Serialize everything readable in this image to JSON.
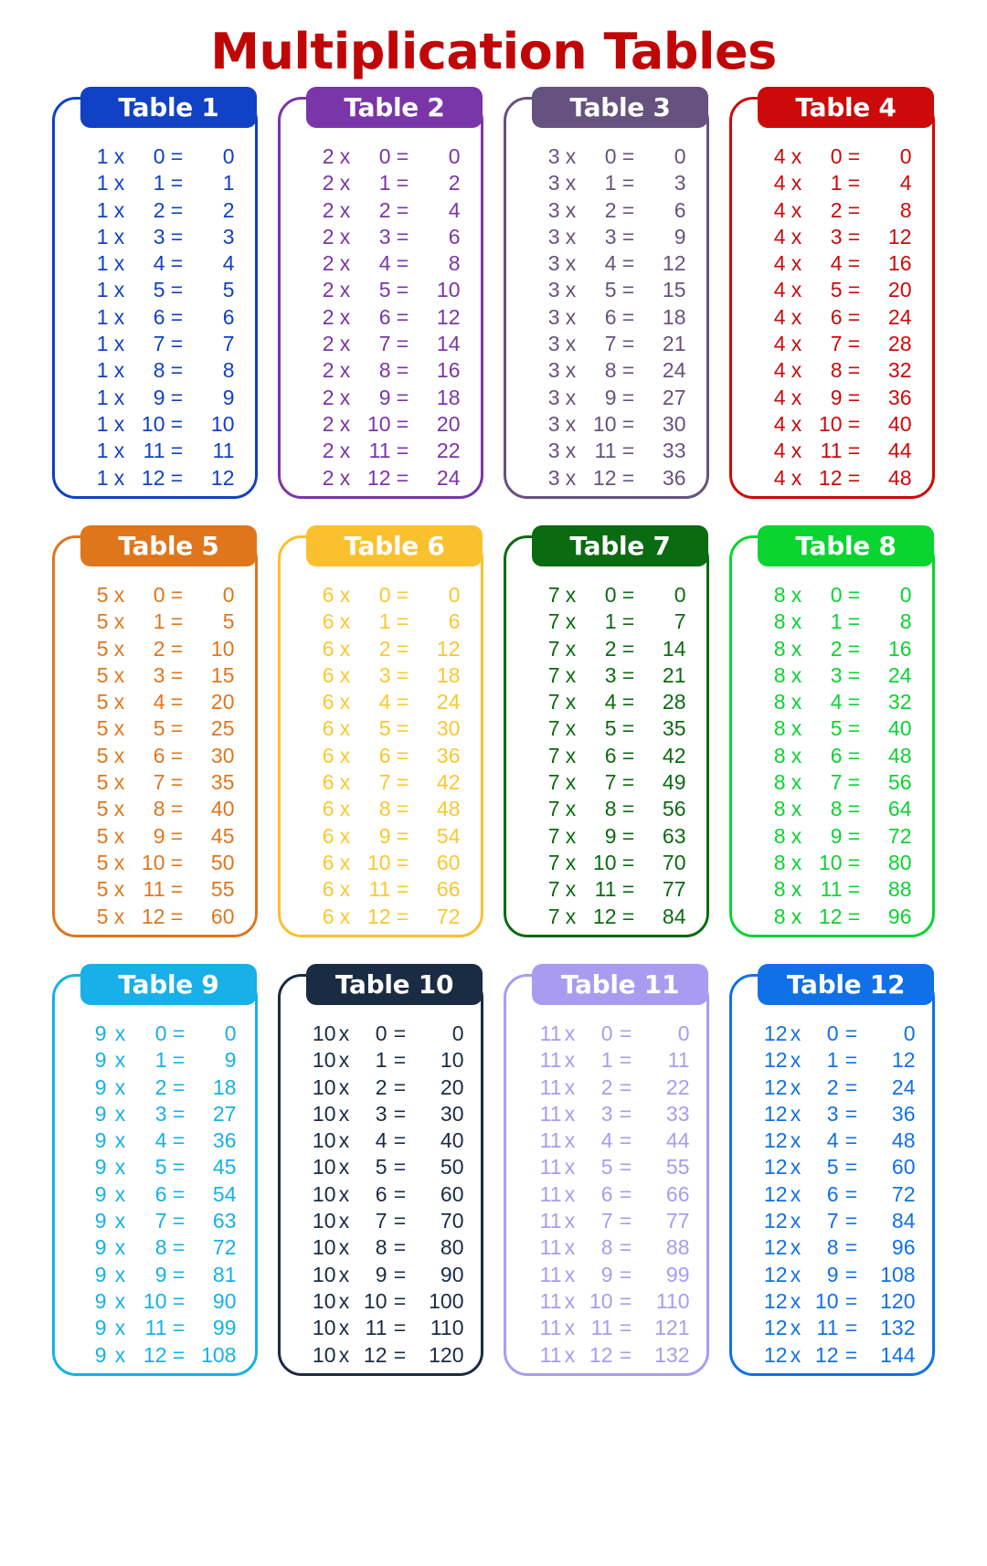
{
  "title": "Multiplication Tables",
  "title_color": "#c00606",
  "columns": 4,
  "operator": "x",
  "equals": "=",
  "tables": [
    {
      "name": "Table 1",
      "color": "#1141c4",
      "header_color": "#1141c4",
      "text_color": "#1141c4",
      "multiplicand": 1,
      "rows": [
        {
          "a": "1",
          "b": "0",
          "r": "0"
        },
        {
          "a": "1",
          "b": "1",
          "r": "1"
        },
        {
          "a": "1",
          "b": "2",
          "r": "2"
        },
        {
          "a": "1",
          "b": "3",
          "r": "3"
        },
        {
          "a": "1",
          "b": "4",
          "r": "4"
        },
        {
          "a": "1",
          "b": "5",
          "r": "5"
        },
        {
          "a": "1",
          "b": "6",
          "r": "6"
        },
        {
          "a": "1",
          "b": "7",
          "r": "7"
        },
        {
          "a": "1",
          "b": "8",
          "r": "8"
        },
        {
          "a": "1",
          "b": "9",
          "r": "9"
        },
        {
          "a": "1",
          "b": "10",
          "r": "10"
        },
        {
          "a": "1",
          "b": "11",
          "r": "11"
        },
        {
          "a": "1",
          "b": "12",
          "r": "12"
        }
      ]
    },
    {
      "name": "Table 2",
      "color": "#7a35a8",
      "header_color": "#7a35a8",
      "text_color": "#7a35a8",
      "multiplicand": 2,
      "rows": [
        {
          "a": "2",
          "b": "0",
          "r": "0"
        },
        {
          "a": "2",
          "b": "1",
          "r": "2"
        },
        {
          "a": "2",
          "b": "2",
          "r": "4"
        },
        {
          "a": "2",
          "b": "3",
          "r": "6"
        },
        {
          "a": "2",
          "b": "4",
          "r": "8"
        },
        {
          "a": "2",
          "b": "5",
          "r": "10"
        },
        {
          "a": "2",
          "b": "6",
          "r": "12"
        },
        {
          "a": "2",
          "b": "7",
          "r": "14"
        },
        {
          "a": "2",
          "b": "8",
          "r": "16"
        },
        {
          "a": "2",
          "b": "9",
          "r": "18"
        },
        {
          "a": "2",
          "b": "10",
          "r": "20"
        },
        {
          "a": "2",
          "b": "11",
          "r": "22"
        },
        {
          "a": "2",
          "b": "12",
          "r": "24"
        }
      ]
    },
    {
      "name": "Table 3",
      "color": "#66527e",
      "header_color": "#66527e",
      "text_color": "#66527e",
      "multiplicand": 3,
      "rows": [
        {
          "a": "3",
          "b": "0",
          "r": "0"
        },
        {
          "a": "3",
          "b": "1",
          "r": "3"
        },
        {
          "a": "3",
          "b": "2",
          "r": "6"
        },
        {
          "a": "3",
          "b": "3",
          "r": "9"
        },
        {
          "a": "3",
          "b": "4",
          "r": "12"
        },
        {
          "a": "3",
          "b": "5",
          "r": "15"
        },
        {
          "a": "3",
          "b": "6",
          "r": "18"
        },
        {
          "a": "3",
          "b": "7",
          "r": "21"
        },
        {
          "a": "3",
          "b": "8",
          "r": "24"
        },
        {
          "a": "3",
          "b": "9",
          "r": "27"
        },
        {
          "a": "3",
          "b": "10",
          "r": "30"
        },
        {
          "a": "3",
          "b": "11",
          "r": "33"
        },
        {
          "a": "3",
          "b": "12",
          "r": "36"
        }
      ]
    },
    {
      "name": "Table 4",
      "color": "#cc0a0a",
      "header_color": "#cc0a0a",
      "text_color": "#cc0a0a",
      "multiplicand": 4,
      "rows": [
        {
          "a": "4",
          "b": "0",
          "r": "0"
        },
        {
          "a": "4",
          "b": "1",
          "r": "4"
        },
        {
          "a": "4",
          "b": "2",
          "r": "8"
        },
        {
          "a": "4",
          "b": "3",
          "r": "12"
        },
        {
          "a": "4",
          "b": "4",
          "r": "16"
        },
        {
          "a": "4",
          "b": "5",
          "r": "20"
        },
        {
          "a": "4",
          "b": "6",
          "r": "24"
        },
        {
          "a": "4",
          "b": "7",
          "r": "28"
        },
        {
          "a": "4",
          "b": "8",
          "r": "32"
        },
        {
          "a": "4",
          "b": "9",
          "r": "36"
        },
        {
          "a": "4",
          "b": "10",
          "r": "40"
        },
        {
          "a": "4",
          "b": "11",
          "r": "44"
        },
        {
          "a": "4",
          "b": "12",
          "r": "48"
        }
      ]
    },
    {
      "name": "Table 5",
      "color": "#e0761c",
      "header_color": "#e0761c",
      "text_color": "#e0761c",
      "multiplicand": 5,
      "rows": [
        {
          "a": "5",
          "b": "0",
          "r": "0"
        },
        {
          "a": "5",
          "b": "1",
          "r": "5"
        },
        {
          "a": "5",
          "b": "2",
          "r": "10"
        },
        {
          "a": "5",
          "b": "3",
          "r": "15"
        },
        {
          "a": "5",
          "b": "4",
          "r": "20"
        },
        {
          "a": "5",
          "b": "5",
          "r": "25"
        },
        {
          "a": "5",
          "b": "6",
          "r": "30"
        },
        {
          "a": "5",
          "b": "7",
          "r": "35"
        },
        {
          "a": "5",
          "b": "8",
          "r": "40"
        },
        {
          "a": "5",
          "b": "9",
          "r": "45"
        },
        {
          "a": "5",
          "b": "10",
          "r": "50"
        },
        {
          "a": "5",
          "b": "11",
          "r": "55"
        },
        {
          "a": "5",
          "b": "12",
          "r": "60"
        }
      ]
    },
    {
      "name": "Table 6",
      "color": "#fbc02d",
      "header_color": "#fbc02d",
      "text_color": "#fbc72f",
      "multiplicand": 6,
      "rows": [
        {
          "a": "6",
          "b": "0",
          "r": "0"
        },
        {
          "a": "6",
          "b": "1",
          "r": "6"
        },
        {
          "a": "6",
          "b": "2",
          "r": "12"
        },
        {
          "a": "6",
          "b": "3",
          "r": "18"
        },
        {
          "a": "6",
          "b": "4",
          "r": "24"
        },
        {
          "a": "6",
          "b": "5",
          "r": "30"
        },
        {
          "a": "6",
          "b": "6",
          "r": "36"
        },
        {
          "a": "6",
          "b": "7",
          "r": "42"
        },
        {
          "a": "6",
          "b": "8",
          "r": "48"
        },
        {
          "a": "6",
          "b": "9",
          "r": "54"
        },
        {
          "a": "6",
          "b": "10",
          "r": "60"
        },
        {
          "a": "6",
          "b": "11",
          "r": "66"
        },
        {
          "a": "6",
          "b": "12",
          "r": "72"
        }
      ]
    },
    {
      "name": "Table 7",
      "color": "#0a6b11",
      "header_color": "#0a6b11",
      "text_color": "#0a6b11",
      "multiplicand": 7,
      "rows": [
        {
          "a": "7",
          "b": "0",
          "r": "0"
        },
        {
          "a": "7",
          "b": "1",
          "r": "7"
        },
        {
          "a": "7",
          "b": "2",
          "r": "14"
        },
        {
          "a": "7",
          "b": "3",
          "r": "21"
        },
        {
          "a": "7",
          "b": "4",
          "r": "28"
        },
        {
          "a": "7",
          "b": "5",
          "r": "35"
        },
        {
          "a": "7",
          "b": "6",
          "r": "42"
        },
        {
          "a": "7",
          "b": "7",
          "r": "49"
        },
        {
          "a": "7",
          "b": "8",
          "r": "56"
        },
        {
          "a": "7",
          "b": "9",
          "r": "63"
        },
        {
          "a": "7",
          "b": "10",
          "r": "70"
        },
        {
          "a": "7",
          "b": "11",
          "r": "77"
        },
        {
          "a": "7",
          "b": "12",
          "r": "84"
        }
      ]
    },
    {
      "name": "Table 8",
      "color": "#0ad430",
      "header_color": "#0ad430",
      "text_color": "#0ad430",
      "multiplicand": 8,
      "rows": [
        {
          "a": "8",
          "b": "0",
          "r": "0"
        },
        {
          "a": "8",
          "b": "1",
          "r": "8"
        },
        {
          "a": "8",
          "b": "2",
          "r": "16"
        },
        {
          "a": "8",
          "b": "3",
          "r": "24"
        },
        {
          "a": "8",
          "b": "4",
          "r": "32"
        },
        {
          "a": "8",
          "b": "5",
          "r": "40"
        },
        {
          "a": "8",
          "b": "6",
          "r": "48"
        },
        {
          "a": "8",
          "b": "7",
          "r": "56"
        },
        {
          "a": "8",
          "b": "8",
          "r": "64"
        },
        {
          "a": "8",
          "b": "9",
          "r": "72"
        },
        {
          "a": "8",
          "b": "10",
          "r": "80"
        },
        {
          "a": "8",
          "b": "11",
          "r": "88"
        },
        {
          "a": "8",
          "b": "12",
          "r": "96"
        }
      ]
    },
    {
      "name": "Table 9",
      "color": "#17b0e8",
      "header_color": "#17b0e8",
      "text_color": "#17b0e8",
      "multiplicand": 9,
      "rows": [
        {
          "a": "9",
          "b": "0",
          "r": "0"
        },
        {
          "a": "9",
          "b": "1",
          "r": "9"
        },
        {
          "a": "9",
          "b": "2",
          "r": "18"
        },
        {
          "a": "9",
          "b": "3",
          "r": "27"
        },
        {
          "a": "9",
          "b": "4",
          "r": "36"
        },
        {
          "a": "9",
          "b": "5",
          "r": "45"
        },
        {
          "a": "9",
          "b": "6",
          "r": "54"
        },
        {
          "a": "9",
          "b": "7",
          "r": "63"
        },
        {
          "a": "9",
          "b": "8",
          "r": "72"
        },
        {
          "a": "9",
          "b": "9",
          "r": "81"
        },
        {
          "a": "9",
          "b": "10",
          "r": "90"
        },
        {
          "a": "9",
          "b": "11",
          "r": "99"
        },
        {
          "a": "9",
          "b": "12",
          "r": "108"
        }
      ]
    },
    {
      "name": "Table 10",
      "color": "#1a2c44",
      "header_color": "#1a2c44",
      "text_color": "#1a2c44",
      "multiplicand": 10,
      "rows": [
        {
          "a": "10",
          "b": "0",
          "r": "0"
        },
        {
          "a": "10",
          "b": "1",
          "r": "10"
        },
        {
          "a": "10",
          "b": "2",
          "r": "20"
        },
        {
          "a": "10",
          "b": "3",
          "r": "30"
        },
        {
          "a": "10",
          "b": "4",
          "r": "40"
        },
        {
          "a": "10",
          "b": "5",
          "r": "50"
        },
        {
          "a": "10",
          "b": "6",
          "r": "60"
        },
        {
          "a": "10",
          "b": "7",
          "r": "70"
        },
        {
          "a": "10",
          "b": "8",
          "r": "80"
        },
        {
          "a": "10",
          "b": "9",
          "r": "90"
        },
        {
          "a": "10",
          "b": "10",
          "r": "100"
        },
        {
          "a": "10",
          "b": "11",
          "r": "110"
        },
        {
          "a": "10",
          "b": "12",
          "r": "120"
        }
      ]
    },
    {
      "name": "Table 11",
      "color": "#a99cf0",
      "header_color": "#a99cf0",
      "text_color": "#a99cf0",
      "multiplicand": 11,
      "rows": [
        {
          "a": "11",
          "b": "0",
          "r": "0"
        },
        {
          "a": "11",
          "b": "1",
          "r": "11"
        },
        {
          "a": "11",
          "b": "2",
          "r": "22"
        },
        {
          "a": "11",
          "b": "3",
          "r": "33"
        },
        {
          "a": "11",
          "b": "4",
          "r": "44"
        },
        {
          "a": "11",
          "b": "5",
          "r": "55"
        },
        {
          "a": "11",
          "b": "6",
          "r": "66"
        },
        {
          "a": "11",
          "b": "7",
          "r": "77"
        },
        {
          "a": "11",
          "b": "8",
          "r": "88"
        },
        {
          "a": "11",
          "b": "9",
          "r": "99"
        },
        {
          "a": "11",
          "b": "10",
          "r": "110"
        },
        {
          "a": "11",
          "b": "11",
          "r": "121"
        },
        {
          "a": "11",
          "b": "12",
          "r": "132"
        }
      ]
    },
    {
      "name": "Table 12",
      "color": "#1070e8",
      "header_color": "#1070e8",
      "text_color": "#1070e8",
      "multiplicand": 12,
      "rows": [
        {
          "a": "12",
          "b": "0",
          "r": "0"
        },
        {
          "a": "12",
          "b": "1",
          "r": "12"
        },
        {
          "a": "12",
          "b": "2",
          "r": "24"
        },
        {
          "a": "12",
          "b": "3",
          "r": "36"
        },
        {
          "a": "12",
          "b": "4",
          "r": "48"
        },
        {
          "a": "12",
          "b": "5",
          "r": "60"
        },
        {
          "a": "12",
          "b": "6",
          "r": "72"
        },
        {
          "a": "12",
          "b": "7",
          "r": "84"
        },
        {
          "a": "12",
          "b": "8",
          "r": "96"
        },
        {
          "a": "12",
          "b": "9",
          "r": "108"
        },
        {
          "a": "12",
          "b": "10",
          "r": "120"
        },
        {
          "a": "12",
          "b": "11",
          "r": "132"
        },
        {
          "a": "12",
          "b": "12",
          "r": "144"
        }
      ]
    }
  ]
}
